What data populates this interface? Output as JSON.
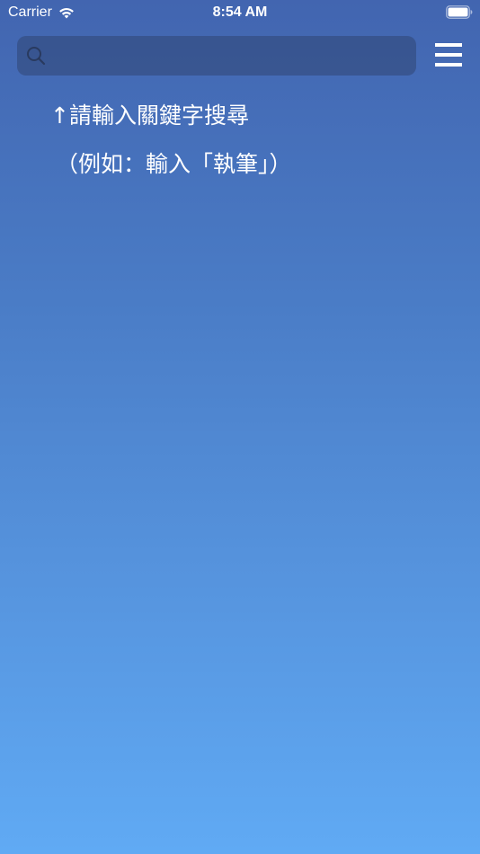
{
  "status_bar": {
    "carrier": "Carrier",
    "time": "8:54 AM",
    "wifi_icon": "wifi-icon",
    "battery_icon": "battery-icon"
  },
  "search": {
    "placeholder": "",
    "value": "",
    "icon": "search-icon"
  },
  "menu": {
    "icon": "hamburger-menu-icon"
  },
  "hint": {
    "line1": "↑請輸入關鍵字搜尋",
    "line2": "（例如：輸入「執筆」）"
  },
  "colors": {
    "background_top": "#4265b0",
    "background_bottom": "#60aaf4",
    "search_bar": "#3a5585",
    "text": "#ffffff"
  }
}
